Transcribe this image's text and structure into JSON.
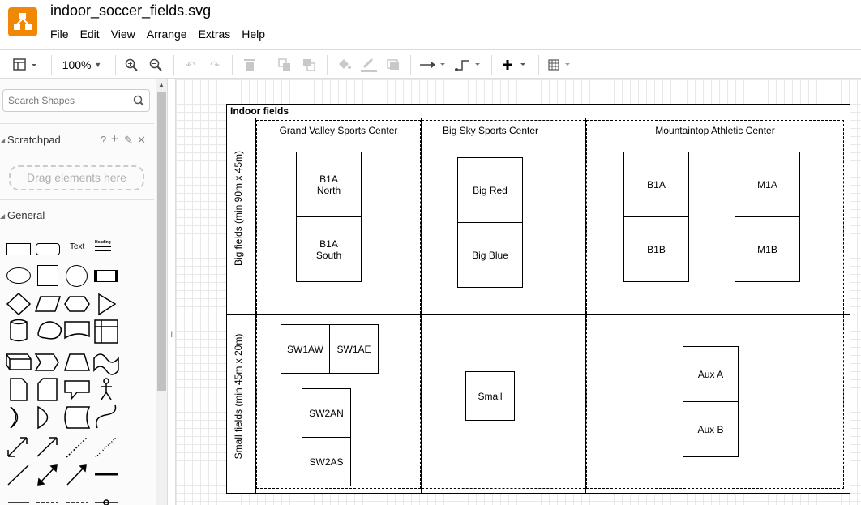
{
  "app": {
    "file_name": "indoor_soccer_fields.svg"
  },
  "menu": [
    "File",
    "Edit",
    "View",
    "Arrange",
    "Extras",
    "Help"
  ],
  "toolbar": {
    "zoom": "100%"
  },
  "sidebar": {
    "search_placeholder": "Search Shapes",
    "scratchpad": "Scratchpad",
    "drag_hint": "Drag elements here",
    "general": "General",
    "text_shape": "Text",
    "heading_shape": "Heading"
  },
  "diagram": {
    "title": "Indoor fields",
    "rows": [
      "Big fields (min 90m x 45m)",
      "Small fields (min 45m x 20m)"
    ],
    "centers": [
      "Grand Valley Sports Center",
      "Big Sky Sports Center",
      "Mountaintop Athletic Center"
    ],
    "fields": {
      "gv_b1a_north": "B1A\nNorth",
      "gv_b1a_south": "B1A\nSouth",
      "bs_big_red": "Big Red",
      "bs_big_blue": "Big Blue",
      "ma_b1a": "B1A",
      "ma_b1b": "B1B",
      "ma_m1a": "M1A",
      "ma_m1b": "M1B",
      "gv_sw1aw": "SW1AW",
      "gv_sw1ae": "SW1AE",
      "gv_sw2an": "SW2AN",
      "gv_sw2as": "SW2AS",
      "bs_small": "Small",
      "ma_aux_a": "Aux A",
      "ma_aux_b": "Aux B"
    }
  }
}
